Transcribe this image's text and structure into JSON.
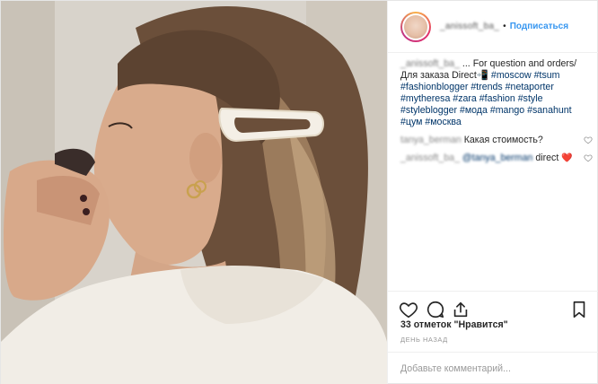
{
  "colors": {
    "link": "#3897f0",
    "hashtag": "#003569",
    "like_red": "#e0262a",
    "divider": "#efefef"
  },
  "header": {
    "username": "_anissoft_ba_",
    "dot": "•",
    "follow_label": "Подписаться"
  },
  "caption": {
    "username": "_anissoft_ba_",
    "text_a": "... For question and orders/ Для заказа Direct📲 ",
    "hashtags": [
      "#moscow",
      "#tsum",
      "#fashionblogger",
      "#trends",
      "#netaporter",
      "#mytheresa",
      "#zara",
      "#fashion",
      "#style",
      "#styleblogger",
      "#мода",
      "#mango",
      "#sanahunt",
      "#цум",
      "#москва"
    ]
  },
  "comments": [
    {
      "username": "tanya_berman",
      "text": "Какая стоимость?"
    },
    {
      "username": "_anissoft_ba_",
      "mention": "@tanya_berman",
      "text": "direct",
      "emoji": "❤️"
    }
  ],
  "icons": {
    "like": "heart-icon",
    "comment": "comment-icon",
    "share": "share-icon",
    "save": "bookmark-icon"
  },
  "likes_text": "33 отметок \"Нравится\"",
  "time_text": "день назад",
  "add_comment_placeholder": "Добавьте комментарий..."
}
